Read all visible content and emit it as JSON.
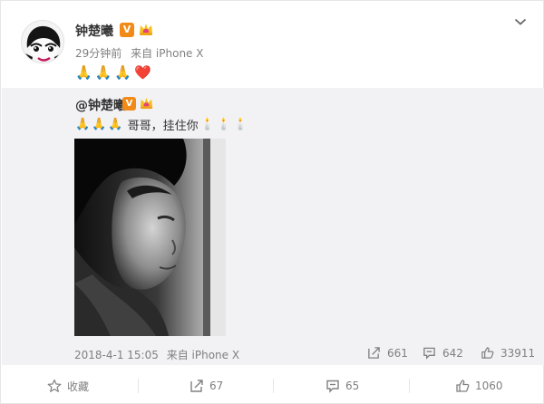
{
  "post": {
    "username": "钟楚曦",
    "verified_label": "V",
    "time": "29分钟前",
    "source": "来自 iPhone X",
    "emojis": [
      "🙏",
      "🙏",
      "🙏",
      "❤️"
    ]
  },
  "repost": {
    "username": "@钟楚曦",
    "verified_label": "V",
    "prayer_emojis": [
      "🙏",
      "🙏",
      "🙏"
    ],
    "text": "哥哥，挂住你",
    "candle_emojis": [
      "🕯️",
      "🕯️",
      "🕯️"
    ],
    "date": "2018-4-1 15:05",
    "source": "来自 iPhone X",
    "shares": "661",
    "comments": "642",
    "likes": "33911"
  },
  "actions": {
    "favorite_label": "收藏",
    "share_count": "67",
    "comment_count": "65",
    "like_count": "1060"
  },
  "colors": {
    "accent_orange": "#f28a17",
    "muted_text": "#808080",
    "repost_bg": "#f2f2f5"
  }
}
